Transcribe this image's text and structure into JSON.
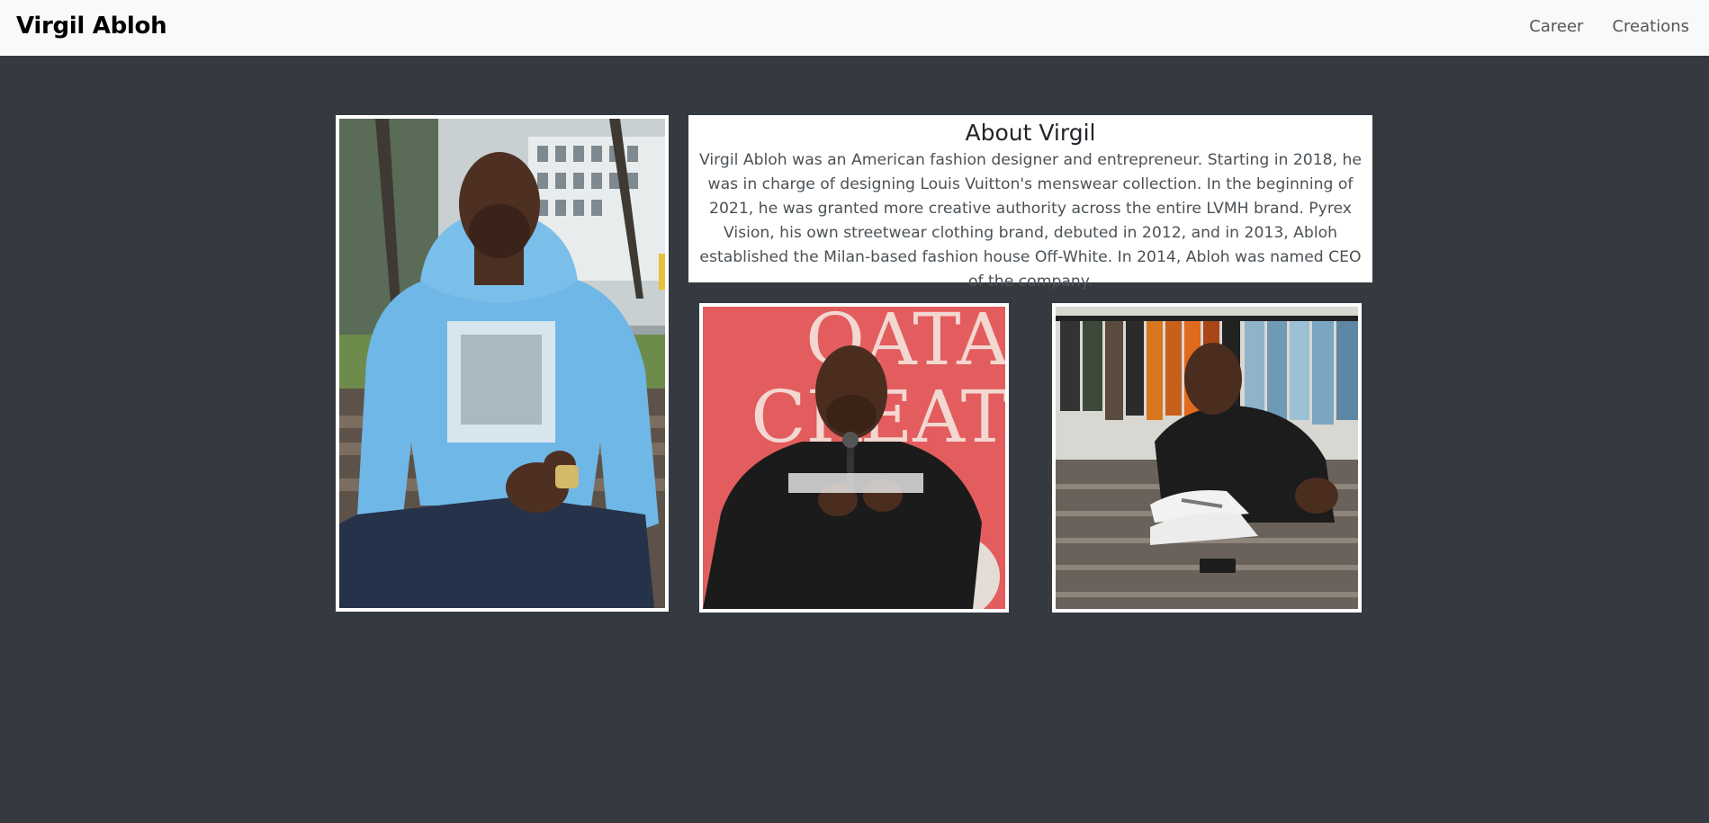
{
  "navbar": {
    "brand": "Virgil Abloh",
    "links": [
      {
        "label": "Career"
      },
      {
        "label": "Creations"
      }
    ]
  },
  "about": {
    "title": "About Virgil",
    "text": "Virgil Abloh was an American fashion designer and entrepreneur. Starting in 2018, he was in charge of designing Louis Vuitton's menswear collection. In the beginning of 2021, he was granted more creative authority across the entire LVMH brand. Pyrex Vision, his own streetwear clothing brand, debuted in 2012, and in 2013, Abloh established the Milan-based fashion house Off-White. In 2014, Abloh was named CEO of the company."
  },
  "photos": [
    {
      "name": "portrait-blue-hoodie"
    },
    {
      "name": "speaking-with-microphone",
      "backdrop_text": [
        "QATA",
        "CREAT"
      ]
    },
    {
      "name": "signing-sneakers"
    }
  ],
  "colors": {
    "page_background": "#343a40",
    "navbar_background": "#f8f9fa",
    "hoodie_blue": "#6fb7e6",
    "backdrop_red": "#e35d5e"
  }
}
